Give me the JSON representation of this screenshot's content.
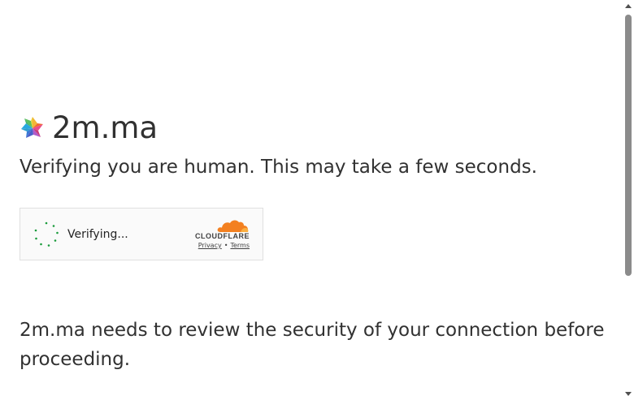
{
  "site": {
    "name": "2m.ma",
    "logo_icon": "pinwheel-logo-icon"
  },
  "challenge": {
    "subtitle": "Verifying you are human. This may take a few seconds.",
    "notice": "2m.ma needs to review the security of your connection before proceeding."
  },
  "widget": {
    "status_label": "Verifying...",
    "spinner_icon": "loading-spinner-icon",
    "brand_wordmark": "CLOUDFLARE",
    "privacy_label": "Privacy",
    "separator": "•",
    "terms_label": "Terms",
    "brand_color": "#f38020",
    "spinner_color": "#1a9b3c"
  },
  "scrollbar": {
    "up_icon": "scroll-up-arrow-icon",
    "down_icon": "scroll-down-arrow-icon"
  }
}
